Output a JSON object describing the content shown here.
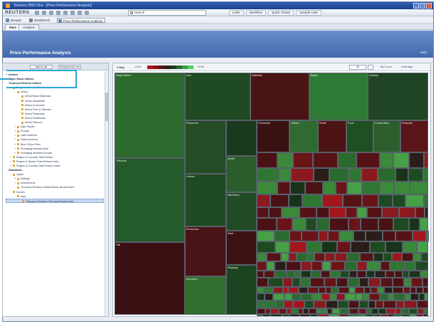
{
  "window": {
    "title": "Reuters 3000 Xtra - [Price Performance Analysis]"
  },
  "menubar": {
    "logo": "REUTERS",
    "search_placeholder": "Search",
    "dropdowns": [
      "Links",
      "Workflow",
      "Quick Charts",
      "Sample Lists"
    ]
  },
  "toolbar2": {
    "items": [
      "Browse",
      "Workbench",
      "Price Performance Analysis"
    ]
  },
  "tabs": [
    "Main",
    "Analysis"
  ],
  "header": {
    "title": "Price Performance Analysis",
    "help": "Help"
  },
  "sidebar": {
    "buttons": [
      "Add to List",
      "Remove from List"
    ],
    "tree": [
      {
        "label": "Indices",
        "level": 0,
        "bold": true,
        "twisty": "+"
      },
      {
        "label": "Major Stock Indices",
        "level": 0,
        "bold": true,
        "twisty": "+"
      },
      {
        "label": "Thomson Reuters Indices",
        "level": 0,
        "bold": true,
        "twisty": "-"
      },
      {
        "label": "Region & Sector Price Index",
        "level": 1,
        "twisty": "-"
      },
      {
        "label": "Africa",
        "level": 2,
        "twisty": "-"
      },
      {
        "label": "Africa Basic Materials",
        "level": 3
      },
      {
        "label": "Africa Industrials",
        "level": 3
      },
      {
        "label": "Africa Consumer",
        "level": 3
      },
      {
        "label": "Africa Tech & Telecom",
        "level": 3
      },
      {
        "label": "Africa Financials",
        "level": 3
      },
      {
        "label": "Africa Healthcare",
        "level": 3
      },
      {
        "label": "Africa Telecom",
        "level": 3
      },
      {
        "label": "Asia Pacific",
        "level": 2,
        "twisty": "+"
      },
      {
        "label": "Europe",
        "level": 2,
        "twisty": "+"
      },
      {
        "label": "Latin America",
        "level": 2,
        "twisty": "+"
      },
      {
        "label": "North America",
        "level": 2,
        "twisty": "+"
      },
      {
        "label": "Blue Chips Price",
        "level": 2,
        "twisty": "+"
      },
      {
        "label": "Emerging Markets Asia",
        "level": 2,
        "twisty": "+"
      },
      {
        "label": "Emerging Markets Europe",
        "level": 2,
        "twisty": "+"
      },
      {
        "label": "Region & Country Total Return",
        "level": 1,
        "twisty": "+"
      },
      {
        "label": "Region & Sector Total Return Index",
        "level": 1,
        "twisty": "+"
      },
      {
        "label": "Region & Country Total Return Index",
        "level": 1,
        "twisty": "+"
      },
      {
        "label": "Standards",
        "level": 0,
        "bold": true,
        "twisty": "-"
      },
      {
        "label": "Lipper",
        "level": 1,
        "twisty": "-"
      },
      {
        "label": "Ratings",
        "level": 2,
        "twisty": "+"
      },
      {
        "label": "Investments",
        "level": 2,
        "twisty": "+"
      },
      {
        "label": "Thomson Reuters Global Banks Broad Index",
        "level": 2
      },
      {
        "label": "Screen",
        "level": 1,
        "twisty": "-"
      },
      {
        "label": "Asia",
        "level": 2,
        "twisty": "-"
      },
      {
        "label": "Thomson Reuters Pan Asia Broad Index",
        "level": 3,
        "selected": true
      }
    ]
  },
  "map": {
    "label": "1 Day",
    "legend_low": "-4.0%",
    "legend_high": "+4.0%",
    "legend_colors": [
      "#b4141c",
      "#8a1418",
      "#5c1416",
      "#2a1e18",
      "#1d3a1f",
      "#2a6a30",
      "#38a040",
      "#50d060"
    ],
    "zoom_value": "25",
    "links": [
      "By Count",
      "Heat Map"
    ],
    "cells": [
      {
        "name": "Mega Market",
        "color": "#2c6a2e"
      },
      {
        "name": "Telecoms",
        "color": "#255a2a"
      },
      {
        "name": "Oils",
        "color": "#3a1012"
      },
      {
        "name": "Auto",
        "color": "#1f4a22"
      },
      {
        "name": "Materials",
        "color": "#4a1415"
      },
      {
        "name": "Banks",
        "color": "#2e7a34"
      },
      {
        "name": "Industry",
        "color": "#1f4524"
      },
      {
        "name": "Resources",
        "color": "#244d26"
      },
      {
        "name": "",
        "color": "#1a3a1d"
      },
      {
        "name": "Chemicals",
        "color": "#3b1214"
      },
      {
        "name": "Utilities",
        "color": "#2f6a30"
      },
      {
        "name": "Retail",
        "color": "#4d1416"
      },
      {
        "name": "Food",
        "color": "#1f5024"
      },
      {
        "name": "Construction",
        "color": "#2c5e2e"
      },
      {
        "name": "Financial",
        "color": "#5a1518"
      },
      {
        "name": "Leisure",
        "color": "#1f4a24"
      },
      {
        "name": "Media",
        "color": "#2a5c2c"
      },
      {
        "name": "Electronics",
        "color": "#4a1315"
      },
      {
        "name": "Machinery",
        "color": "#214a25"
      },
      {
        "name": "Insurance",
        "color": "#30702f"
      },
      {
        "name": "Steel",
        "color": "#3c1214"
      },
      {
        "name": "Shipping",
        "color": "#1d4420"
      }
    ]
  }
}
